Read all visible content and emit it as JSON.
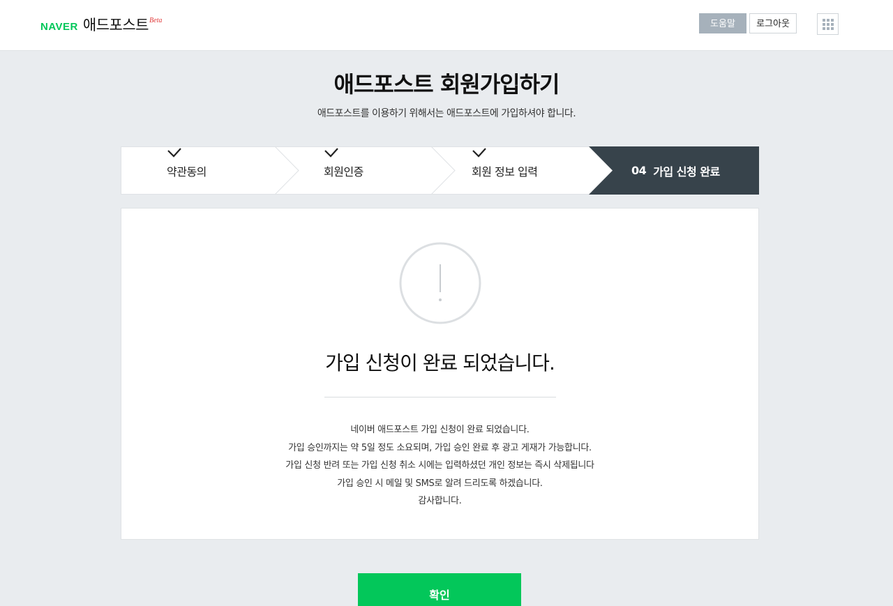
{
  "header": {
    "logo_naver": "NAVER",
    "logo_service": "애드포스트",
    "logo_beta": "Beta",
    "help_label": "도움말",
    "logout_label": "로그아웃",
    "apps_icon": "grid-icon"
  },
  "page": {
    "title": "애드포스트 회원가입하기",
    "subtitle": "애드포스트를 이용하기 위해서는 애드포스트에 가입하셔야 합니다."
  },
  "steps": [
    {
      "label": "약관동의",
      "status": "done"
    },
    {
      "label": "회원인증",
      "status": "done"
    },
    {
      "label": "회원 정보 입력",
      "status": "done"
    },
    {
      "number": "04",
      "label": "가입 신청 완료",
      "status": "active"
    }
  ],
  "colors": {
    "naver_green": "#03c75a",
    "active_step_bg": "#37434b",
    "help_button_bg": "#a6b1bb",
    "page_bg": "#e9ecef",
    "beta_red": "#e03a3a"
  },
  "result": {
    "icon": "exclamation-circle-icon",
    "message": "가입 신청이 완료 되었습니다.",
    "details": [
      "네이버 애드포스트 가입 신청이 완료 되었습니다.",
      "가입 승인까지는 약 5일 정도 소요되며, 가입 승인 완료 후 광고 게재가 가능합니다.",
      "가입 신청 반려 또는 가입 신청 취소 시에는 입력하셨던 개인 정보는 즉시 삭제됩니다",
      "가입 승인 시 메일 및 SMS로 알려 드리도록 하겠습니다.",
      "감사합니다."
    ]
  },
  "confirm_label": "확인"
}
